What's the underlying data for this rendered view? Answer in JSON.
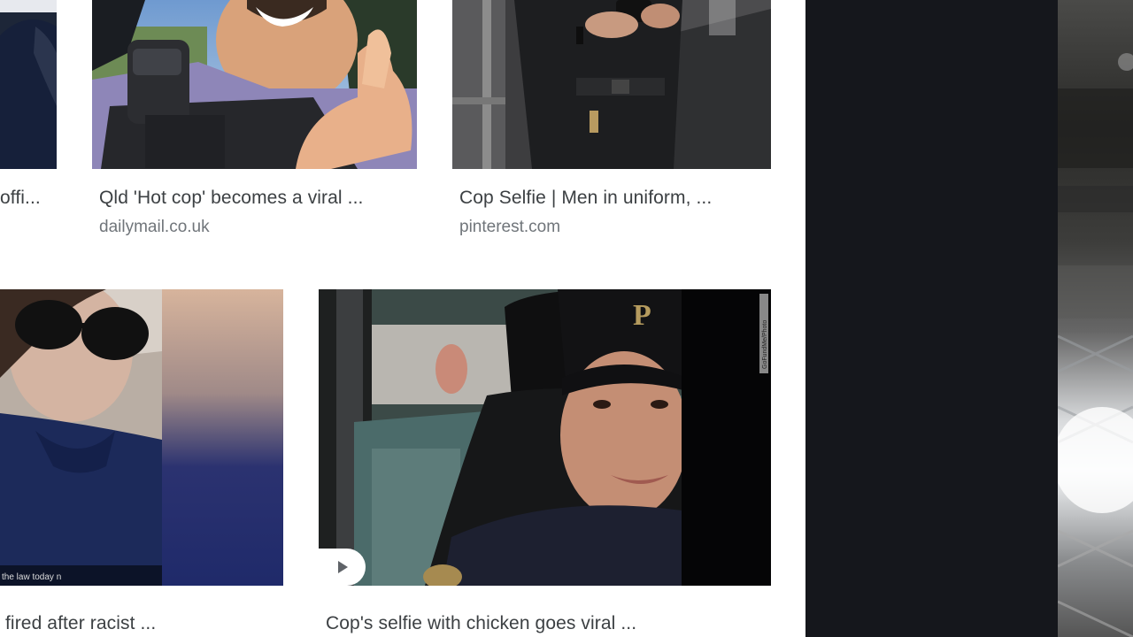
{
  "results": [
    {
      "title": "offi...",
      "source": ""
    },
    {
      "title": "Qld 'Hot cop' becomes a viral ...",
      "source": "dailymail.co.uk"
    },
    {
      "title": "Cop Selfie | Men in uniform, ...",
      "source": "pinterest.com"
    },
    {
      "title": "fired after racist ...",
      "source": ""
    },
    {
      "title": "Cop's selfie with chicken goes viral ...",
      "source": ""
    }
  ],
  "overlays": {
    "caption_fragment": "the law today n",
    "watermark": "GoFundMe/Photo"
  },
  "icons": {
    "play": "play-icon"
  },
  "colors": {
    "title": "#3c4043",
    "source": "#70757a",
    "dark_panel": "#15171c"
  }
}
